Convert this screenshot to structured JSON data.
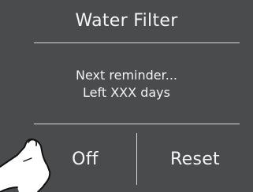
{
  "dialog": {
    "title": "Water Filter",
    "message_line1": "Next reminder...",
    "message_line2": "Left XXX days"
  },
  "buttons": {
    "off_label": "Off",
    "reset_label": "Reset"
  },
  "colors": {
    "background": "#4a4b4d",
    "text": "#f4f4f4",
    "divider": "#d9d9d9"
  },
  "icons": {
    "pointer": "finger-tap-icon"
  }
}
